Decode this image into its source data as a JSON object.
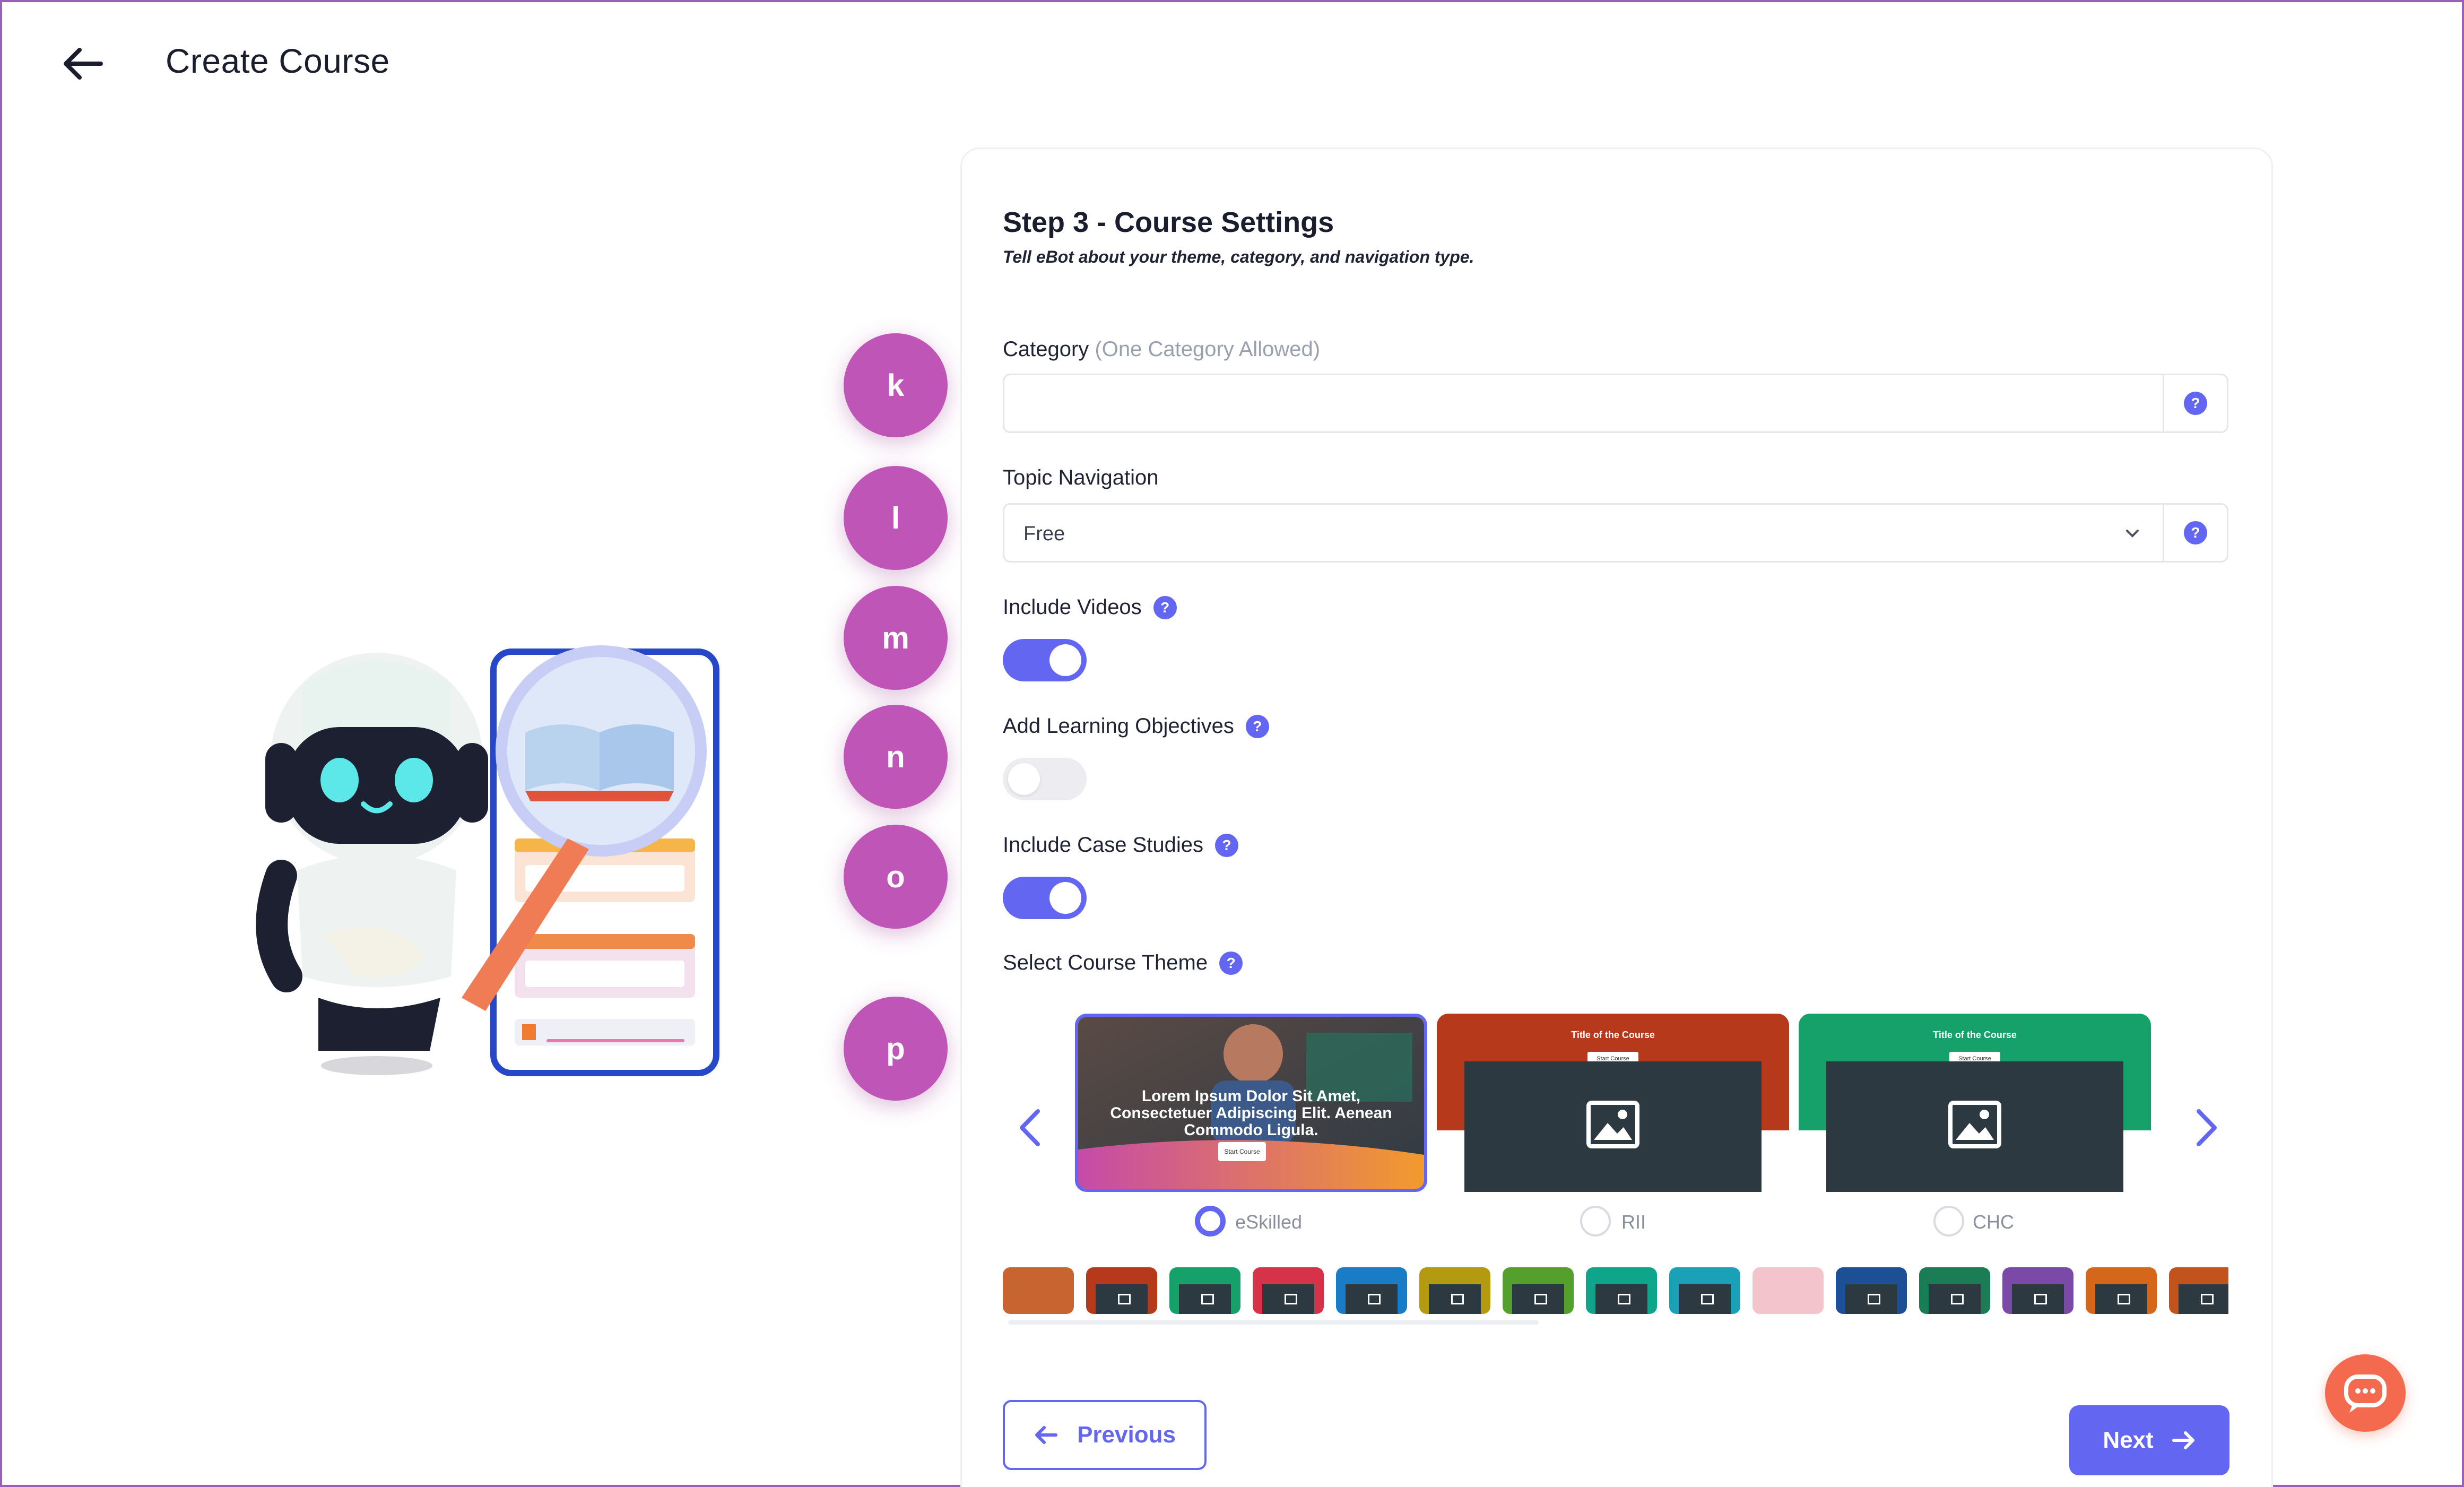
{
  "header": {
    "title": "Create Course"
  },
  "badges": [
    "k",
    "l",
    "m",
    "n",
    "o",
    "p"
  ],
  "step": {
    "title": "Step 3 - Course Settings",
    "subtitle": "Tell eBot about your theme, category, and navigation type."
  },
  "category": {
    "label": "Category",
    "hint": "(One Category Allowed)",
    "value": ""
  },
  "topic_navigation": {
    "label": "Topic Navigation",
    "value": "Free"
  },
  "include_videos": {
    "label": "Include Videos",
    "on": true
  },
  "learning_objectives": {
    "label": "Add Learning Objectives",
    "on": false
  },
  "case_studies": {
    "label": "Include Case Studies",
    "on": true
  },
  "theme": {
    "label": "Select Course Theme",
    "selected": "eSkilled",
    "cards": [
      {
        "name": "eSkilled",
        "text": "Lorem Ipsum Dolor Sit Amet, Consectetuer Adipiscing Elit. Aenean Commodo Ligula.",
        "button": "Start Course"
      },
      {
        "name": "RII",
        "heading": "Title of the Course",
        "button": "Start Course",
        "color": "#b5391a"
      },
      {
        "name": "CHC",
        "heading": "Title of the Course",
        "button": "Start Course",
        "color": "#16a06a"
      }
    ],
    "thumbnail_colors": [
      "#c7642f",
      "#b5391a",
      "#16a06a",
      "#d6334a",
      "#1b7cc6",
      "#b39a11",
      "#55a02c",
      "#0ea58a",
      "#1aa1b8",
      "#f4c4cc",
      "#1c4f95",
      "#1a7d55",
      "#7b4aa8",
      "#d4671a",
      "#c2531c"
    ]
  },
  "actions": {
    "previous": "Previous",
    "next": "Next"
  },
  "help_symbol": "?",
  "colors": {
    "accent": "#6366f1",
    "badge": "#c055b8",
    "chat": "#f36a4f"
  }
}
